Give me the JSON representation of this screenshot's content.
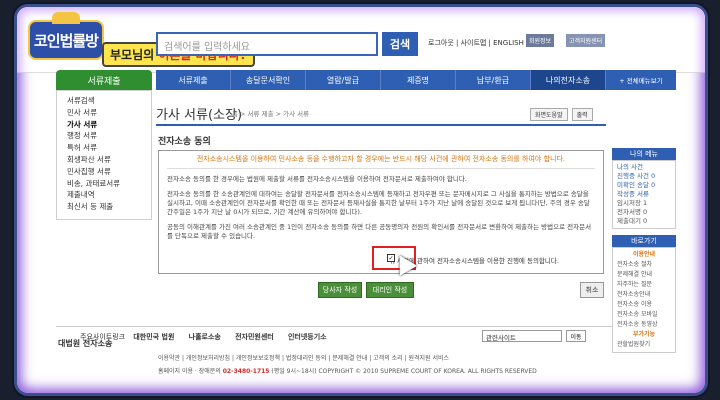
{
  "show": {
    "logo_text": "코인법률방",
    "subtitle_prefix": "부모님의 ",
    "subtitle_highlight": "이혼을 바랍니다?"
  },
  "header": {
    "search_placeholder": "검색어를 입력하세요",
    "search_button": "검색",
    "util_links": "로그아웃 | 사이트맵 | ENGLISH",
    "util_btn1": "회원정보",
    "util_btn2": "고객지원센터"
  },
  "nav": {
    "items": [
      "서류제출",
      "송달문서확인",
      "열람/발급",
      "제증명",
      "납부/환급",
      "나의전자소송"
    ],
    "all_menu": "+ 전체메뉴보기"
  },
  "sidebar": {
    "header": "서류제출",
    "items": [
      "서류검색",
      "민사 서류",
      "가사 서류",
      "행정 서류",
      "특허 서류",
      "회생파산 서류",
      "민사집행 서류",
      "비송, 과태료서류",
      "제출내역",
      "최신서 등 제출"
    ]
  },
  "page": {
    "title": "가사 서류(소장)",
    "breadcrumb": "홈 > 서류 제출 > 가사 서류",
    "tool1": "화면도움말",
    "tool2": "출력",
    "section": "전자소송 동의",
    "warning": "전자소송시스템을 이용하여 민사소송 등을 수행하고자 할 경우에는 반드시 해당 사건에 관하여 전자소송 동의를 하여야 합니다.",
    "p1": "전자소송 동의를 한 경우에는 법원에 제출할 서류를 전자소송시스템을 이용하여 전자문서로 제출하여야 합니다.",
    "p2": "전자소송 동의를 한 소송관계인에 대하여는 송달할 전자문서를 전자소송시스템에 등재하고 전자우편 또는 문자메시지로 그 사실을 통지하는 방법으로 송달을 실시하고, 이때 소송관계인이 전자문서를 확인한 때 또는 전자문서 등재사실을 통지한 날부터 1주가 지난 날에 송달된 것으로 보게 됩니다(단, 주의 경우 송달간주일은 1주가 지난 날 0시가 되므로, 기간 계산에 유의하여야 합니다).",
    "p3": "공동의 이해관계를 가진 여러 소송관계인 중 1인이 전자소송 동의를 하면 다른 공동명의자 전원의 확인서를 전자문서로 변환하여 제출하는 방법으로 전자문서를 단독으로 제출할 수 있습니다.",
    "agree_text": "위 사건에 관하여 전자소송시스템을 이용한 진행에 동의합니다.",
    "btn_self": "당사자 작성",
    "btn_proxy": "대리인 작성",
    "btn_cancel": "취소"
  },
  "right": {
    "header": "나의 메뉴",
    "items": [
      "나의 사건",
      "진행중 사건 0",
      "미확인 송달 0",
      "작성중 서류"
    ],
    "sub": [
      "임시저장 1",
      "전자서명 0",
      "제출대기 0"
    ],
    "card": "바로가기",
    "guide_title": "이용안내",
    "guide": [
      "전자소송 절차",
      "문제해결 안내",
      "자주하는 질문",
      "전자소송안내",
      "전자소송 이용",
      "전자소송 모바일",
      "전자소송 동영상"
    ],
    "guide2_title": "부가기능",
    "guide2": [
      "관할법원찾기"
    ]
  },
  "footer": {
    "org": "대법원 전자소송",
    "links": [
      "주요사이트링크",
      "대한민국 법원",
      "나홀로소송",
      "전자민원센터",
      "인터넷등기소"
    ],
    "select": "관련사이트",
    "go": "이동",
    "line2": "이용약관 | 개인정보처리방침 | 개인정보보호정책 | 법정대리인 동의 | 문제해결 안내 | 고객의 소리 | 원격지원 서비스",
    "line3_prefix": "홈페이지 이용 · 장애문의 ",
    "phone": "02-3480-1715",
    "line3_suffix": " (평일 9시~18시)   COPYRIGHT © 2010 SUPREME COURT OF KOREA. ALL RIGHTS RESERVED"
  }
}
